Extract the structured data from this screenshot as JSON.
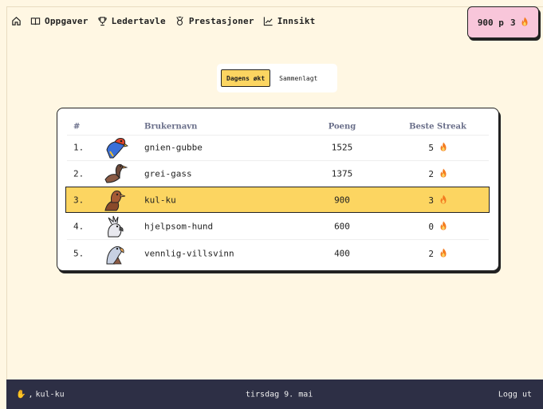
{
  "nav": {
    "items": [
      {
        "label": "Oppgaver",
        "icon": "book-icon"
      },
      {
        "label": "Ledertavle",
        "icon": "trophy-icon"
      },
      {
        "label": "Prestasjoner",
        "icon": "medal-icon"
      },
      {
        "label": "Innsikt",
        "icon": "chart-line-icon"
      }
    ]
  },
  "points_badge": {
    "points": "900 p",
    "streak": "3"
  },
  "toggle": {
    "active": "Dagens økt",
    "other": "Sammenlagt"
  },
  "table": {
    "headers": {
      "rank": "#",
      "name": "Brukernavn",
      "points": "Poeng",
      "streak": "Beste Streak"
    },
    "rows": [
      {
        "rank": "1.",
        "name": "gnien-gubbe",
        "points": "1525",
        "streak": "5"
      },
      {
        "rank": "2.",
        "name": "grei-gass",
        "points": "1375",
        "streak": "2"
      },
      {
        "rank": "3.",
        "name": "kul-ku",
        "points": "900",
        "streak": "3"
      },
      {
        "rank": "4.",
        "name": "hjelpsom-hund",
        "points": "600",
        "streak": "0"
      },
      {
        "rank": "5.",
        "name": "vennlig-villsvinn",
        "points": "400",
        "streak": "2"
      }
    ]
  },
  "footer": {
    "user": "kul-ku",
    "date": "tirsdag 9. mai",
    "logout": "Logg ut"
  },
  "colors": {
    "background": "#fff7e3",
    "highlight": "#fcd561",
    "badge": "#f8c6da",
    "footer": "#2d2f45"
  }
}
